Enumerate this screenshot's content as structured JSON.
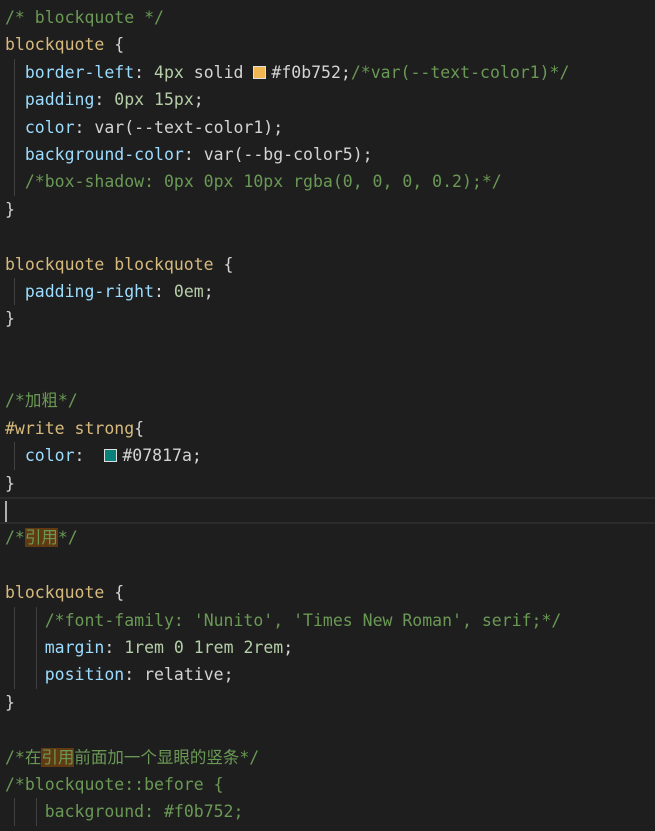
{
  "editor": {
    "colors": {
      "background": "#1e1e1e",
      "comment": "#6a9955",
      "selector": "#d7ba7d",
      "property": "#9cdcfe",
      "number": "#b5cea8",
      "plain": "#d4d4d4",
      "string": "#ce9178",
      "find_highlight": "#613a11"
    },
    "current_line": 18,
    "lines": [
      {
        "guides": [],
        "tokens": [
          {
            "t": "comment",
            "v": "/* blockquote */"
          }
        ]
      },
      {
        "guides": [],
        "tokens": [
          {
            "t": "selector",
            "v": "blockquote"
          },
          {
            "t": "plain",
            "v": " {"
          }
        ]
      },
      {
        "guides": [
          1
        ],
        "tokens": [
          {
            "t": "plain",
            "v": "  "
          },
          {
            "t": "prop",
            "v": "border-left"
          },
          {
            "t": "plain",
            "v": ": "
          },
          {
            "t": "num",
            "v": "4px"
          },
          {
            "t": "plain",
            "v": " solid "
          },
          {
            "t": "swatch",
            "color": "#f0b752"
          },
          {
            "t": "plain",
            "v": "#f0b752;"
          },
          {
            "t": "comment",
            "v": "/*var(--text-color1)*/"
          }
        ]
      },
      {
        "guides": [
          1
        ],
        "tokens": [
          {
            "t": "plain",
            "v": "  "
          },
          {
            "t": "prop",
            "v": "padding"
          },
          {
            "t": "plain",
            "v": ": "
          },
          {
            "t": "num",
            "v": "0px"
          },
          {
            "t": "plain",
            "v": " "
          },
          {
            "t": "num",
            "v": "15px"
          },
          {
            "t": "plain",
            "v": ";"
          }
        ]
      },
      {
        "guides": [
          1
        ],
        "tokens": [
          {
            "t": "plain",
            "v": "  "
          },
          {
            "t": "prop",
            "v": "color"
          },
          {
            "t": "plain",
            "v": ": var(--text-color1);"
          }
        ]
      },
      {
        "guides": [
          1
        ],
        "tokens": [
          {
            "t": "plain",
            "v": "  "
          },
          {
            "t": "prop",
            "v": "background-color"
          },
          {
            "t": "plain",
            "v": ": var(--bg-color5);"
          }
        ]
      },
      {
        "guides": [
          1
        ],
        "tokens": [
          {
            "t": "plain",
            "v": "  "
          },
          {
            "t": "comment",
            "v": "/*box-shadow: 0px 0px 10px rgba(0, 0, 0, 0.2);*/"
          }
        ]
      },
      {
        "guides": [],
        "tokens": [
          {
            "t": "plain",
            "v": "}"
          }
        ]
      },
      {
        "guides": [],
        "tokens": []
      },
      {
        "guides": [],
        "tokens": [
          {
            "t": "selector",
            "v": "blockquote blockquote"
          },
          {
            "t": "plain",
            "v": " {"
          }
        ]
      },
      {
        "guides": [
          1
        ],
        "tokens": [
          {
            "t": "plain",
            "v": "  "
          },
          {
            "t": "prop",
            "v": "padding-right"
          },
          {
            "t": "plain",
            "v": ": "
          },
          {
            "t": "num",
            "v": "0em"
          },
          {
            "t": "plain",
            "v": ";"
          }
        ]
      },
      {
        "guides": [],
        "tokens": [
          {
            "t": "plain",
            "v": "}"
          }
        ]
      },
      {
        "guides": [],
        "tokens": []
      },
      {
        "guides": [],
        "tokens": []
      },
      {
        "guides": [],
        "tokens": [
          {
            "t": "comment",
            "v": "/*加粗*/"
          }
        ]
      },
      {
        "guides": [],
        "tokens": [
          {
            "t": "selector",
            "v": "#write strong"
          },
          {
            "t": "plain",
            "v": "{"
          }
        ]
      },
      {
        "guides": [
          1
        ],
        "tokens": [
          {
            "t": "plain",
            "v": "  "
          },
          {
            "t": "prop",
            "v": "color"
          },
          {
            "t": "plain",
            "v": ":  "
          },
          {
            "t": "swatch",
            "color": "#07817a"
          },
          {
            "t": "plain",
            "v": "#07817a;"
          }
        ]
      },
      {
        "guides": [],
        "tokens": [
          {
            "t": "plain",
            "v": "}"
          }
        ]
      },
      {
        "guides": [],
        "tokens": [
          {
            "t": "cursor"
          }
        ]
      },
      {
        "guides": [],
        "tokens": [
          {
            "t": "comment",
            "v": "/*"
          },
          {
            "t": "comment",
            "hl": true,
            "v": "引用"
          },
          {
            "t": "comment",
            "v": "*/"
          }
        ]
      },
      {
        "guides": [],
        "tokens": []
      },
      {
        "guides": [],
        "tokens": [
          {
            "t": "selector",
            "v": "blockquote"
          },
          {
            "t": "plain",
            "v": " {"
          }
        ]
      },
      {
        "guides": [
          1,
          2
        ],
        "tokens": [
          {
            "t": "plain",
            "v": "    "
          },
          {
            "t": "comment",
            "v": "/*font-family: 'Nunito', 'Times New Roman', serif;*/"
          }
        ]
      },
      {
        "guides": [
          1,
          2
        ],
        "tokens": [
          {
            "t": "plain",
            "v": "    "
          },
          {
            "t": "prop",
            "v": "margin"
          },
          {
            "t": "plain",
            "v": ": "
          },
          {
            "t": "num",
            "v": "1rem"
          },
          {
            "t": "plain",
            "v": " "
          },
          {
            "t": "num",
            "v": "0"
          },
          {
            "t": "plain",
            "v": " "
          },
          {
            "t": "num",
            "v": "1rem"
          },
          {
            "t": "plain",
            "v": " "
          },
          {
            "t": "num",
            "v": "2rem"
          },
          {
            "t": "plain",
            "v": ";"
          }
        ]
      },
      {
        "guides": [
          1,
          2
        ],
        "tokens": [
          {
            "t": "plain",
            "v": "    "
          },
          {
            "t": "prop",
            "v": "position"
          },
          {
            "t": "plain",
            "v": ": relative;"
          }
        ]
      },
      {
        "guides": [],
        "tokens": [
          {
            "t": "plain",
            "v": "}"
          }
        ]
      },
      {
        "guides": [],
        "tokens": []
      },
      {
        "guides": [],
        "tokens": [
          {
            "t": "comment",
            "v": "/*在"
          },
          {
            "t": "comment",
            "hl": true,
            "v": "引用"
          },
          {
            "t": "comment",
            "v": "前面加一个显眼的竖条*/"
          }
        ]
      },
      {
        "guides": [],
        "tokens": [
          {
            "t": "comment",
            "v": "/*blockquote::before {"
          }
        ]
      },
      {
        "guides": [
          1,
          2
        ],
        "tokens": [
          {
            "t": "plain",
            "v": "    "
          },
          {
            "t": "comment",
            "v": "background: #f0b752;"
          }
        ]
      }
    ]
  }
}
